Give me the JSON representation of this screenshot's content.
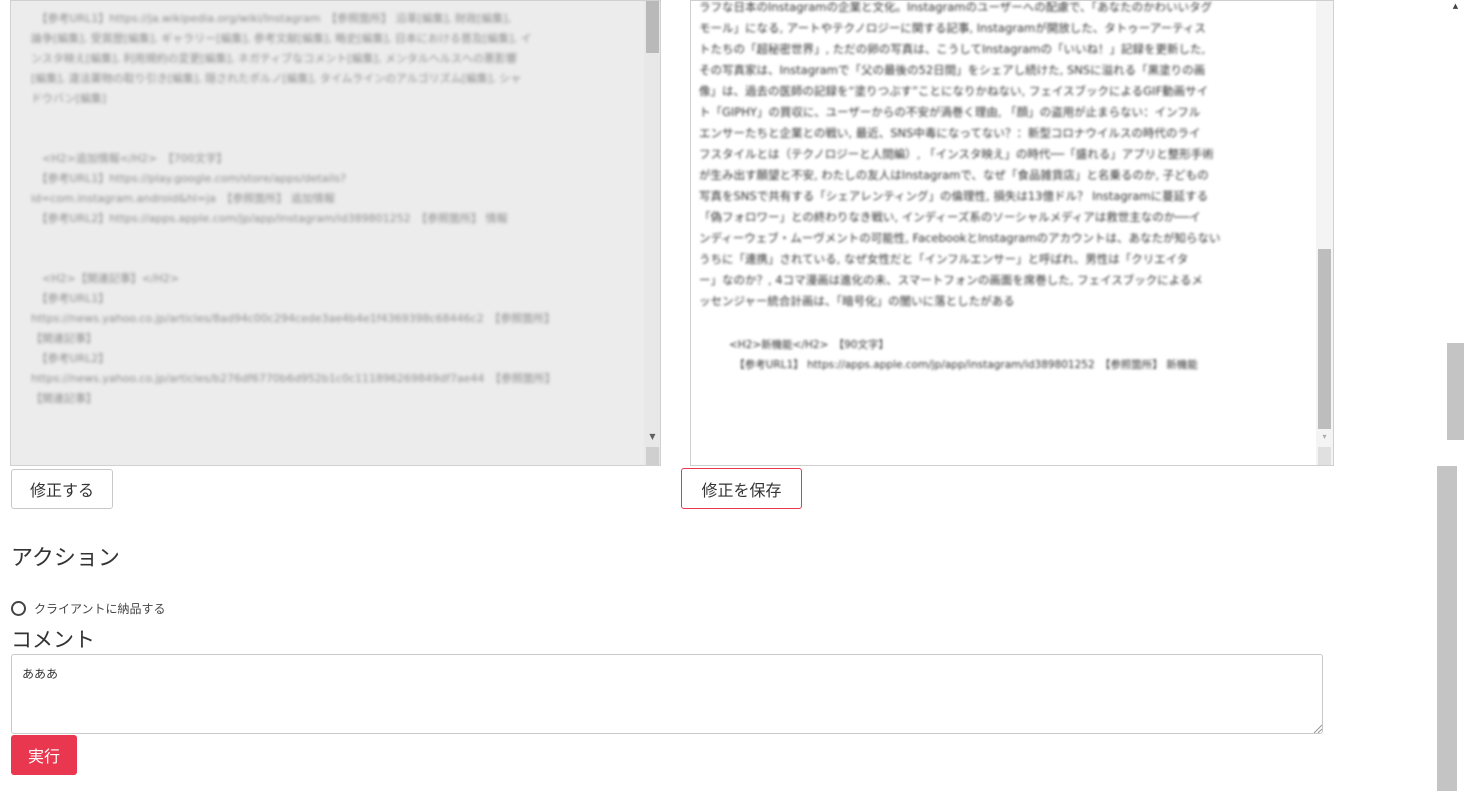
{
  "left_panel": {
    "content": "　【参考URL1】https://ja.wikipedia.org/wiki/Instagram　【参照箇所】 沿革[編集], 財政[編集],\n論争[編集], 受賞歴[編集], ギャラリー[編集], 参考文献[編集], 略史[編集], 日本における普及[編集], イ\nンスタ映え[編集], 利用規約の変更[編集], ネガティブなコメント[編集], メンタルヘルスへの悪影響\n[編集], 違法薬物の取り引き[編集], 隠されたポルノ[編集], タイムラインのアルゴリズム[編集], シャ\nドウバン[編集]\n\n\n　<H2>追加情報</H2>　【700文字】\n　【参考URL1】https://play.google.com/store/apps/details?\nid=com.instagram.android&hl=ja　【参照箇所】 追加情報\n　【参考URL2】https://apps.apple.com/jp/app/instagram/id389801252　【参照箇所】 情報\n\n\n　<H2>【関連記事】</H2>\n　【参考URL1】\nhttps://news.yahoo.co.jp/articles/8ad94c00c294cede3ae4b4e1f4369398c68446c2　【参照箇所】\n【関連記事】\n　【参考URL2】\nhttps://news.yahoo.co.jp/articles/b276df6770b6d952b1c0c111896269849df7ae44　【参照箇所】\n【関連記事】"
  },
  "right_panel": {
    "content": "ラフな日本のInstagramの企業と文化。Instagramのユーザーへの配慮で、「あなたのかわいいタグ\nモール」になる, アートやテクノロジーに関する記事, Instagramが開放した、タトゥーアーティス\nトたちの「超秘密世界」, ただの卵の写真は、こうしてInstagramの「いいね！」記録を更新した,\nその写真家は、Instagramで「父の最後の52日間」をシェアし続けた, SNSに溢れる「黒塗りの画\n像」は、過去の医師の記録を“塗りつぶす”ことになりかねない, フェイスブックによるGIF動画サイ\nト「GIPHY」の買収に、ユーザーからの不安が渦巻く理由, 「顔」の盗用が止まらない：インフル\nエンサーたちと企業との戦い, 最近、SNS中毒になってない？：新型コロナウイルスの時代のライ\nフスタイルとは（テクノロジーと人間編）, 「インスタ映え」の時代──「盛れる」アプリと整形手術\nが生み出す願望と不安, わたしの友人はInstagramで、なぜ「食品雑貨店」と名乗るのか, 子どもの\n写真をSNSで共有する「シェアレンティング」の倫理性, 損失は13億ドル？ Instagramに蔓延する\n「偽フォロワー」との終わりなき戦い, インディーズ系のソーシャルメディアは救世主なのか──イ\nンディーウェブ・ムーヴメントの可能性, FacebookとInstagramのアカウントは、あなたが知らない\nうちに「連携」されている, なぜ女性だと「インフルエンサー」と呼ばれ、男性は「クリエイタ\nー」なのか？, 4コマ漫画は進化の未、スマートフォンの画面を席巻した, フェイスブックによるメ\nッセンジャー統合計画は、「暗号化」の闇いに落としたがある",
    "h2_block": "<H2>新機能</H2>　【90文字】\n　【参考URL1】 https://apps.apple.com/jp/app/instagram/id389801252　【参照箇所】 新機能"
  },
  "buttons": {
    "edit": "修正する",
    "save": "修正を保存",
    "run": "実行"
  },
  "action": {
    "heading": "アクション",
    "radio_label": "クライアントに納品する"
  },
  "comment": {
    "heading": "コメント",
    "value": "あああ"
  },
  "colors": {
    "accent": "#e8374f",
    "panel_bg": "#ececec"
  }
}
